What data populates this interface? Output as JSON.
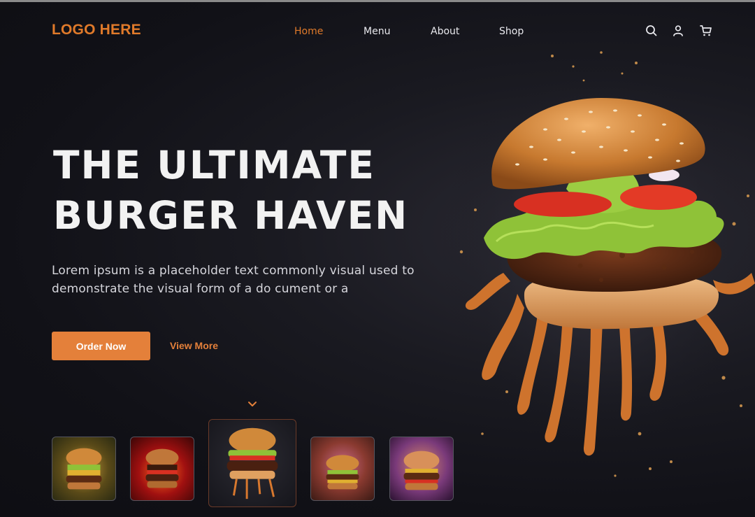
{
  "header": {
    "logo": "LOGO HERE",
    "nav": [
      {
        "label": "Home",
        "active": true
      },
      {
        "label": "Menu",
        "active": false
      },
      {
        "label": "About",
        "active": false
      },
      {
        "label": "Shop",
        "active": false
      }
    ],
    "icons": [
      "search-icon",
      "user-icon",
      "cart-icon"
    ]
  },
  "hero": {
    "title_line1": "THE ULTIMATE",
    "title_line2": "BURGER HAVEN",
    "description": "Lorem ipsum is a placeholder text commonly visual used to demonstrate the visual form of a do cument or a",
    "order_button": "Order Now",
    "view_more": "View More"
  },
  "thumbnails": [
    {
      "name": "thumb-burger-1",
      "selected": false
    },
    {
      "name": "thumb-burger-2",
      "selected": false
    },
    {
      "name": "thumb-burger-3",
      "selected": true
    },
    {
      "name": "thumb-burger-4",
      "selected": false
    },
    {
      "name": "thumb-burger-5",
      "selected": false
    }
  ],
  "colors": {
    "accent": "#e4803a",
    "background": "#111117",
    "text": "#f2f2f2"
  }
}
